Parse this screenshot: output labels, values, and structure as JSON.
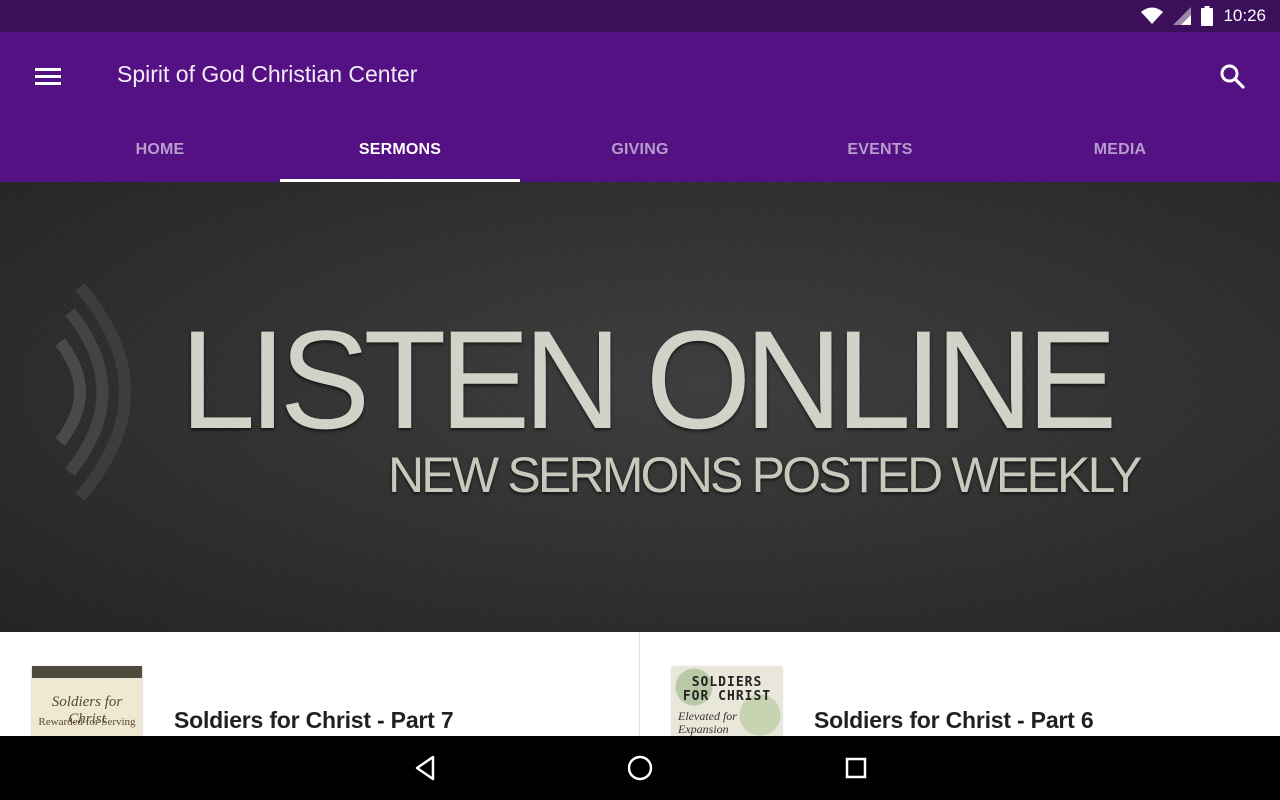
{
  "status_bar": {
    "time": "10:26",
    "icons": [
      "wifi-icon",
      "signal-icon",
      "battery-icon"
    ]
  },
  "app_bar": {
    "title": "Spirit of God Christian Center",
    "menu_icon": "hamburger-menu-icon",
    "search_icon": "search-icon",
    "background_color": "#541183"
  },
  "tabs": [
    {
      "label": "HOME",
      "active": false
    },
    {
      "label": "SERMONS",
      "active": true
    },
    {
      "label": "GIVING",
      "active": false
    },
    {
      "label": "EVENTS",
      "active": false
    },
    {
      "label": "MEDIA",
      "active": false
    }
  ],
  "hero": {
    "title": "LISTEN ONLINE",
    "subtitle": "NEW SERMONS POSTED WEEKLY"
  },
  "sermons": [
    {
      "title": "Soldiers for Christ - Part 7",
      "thumb_line1": "Soldiers for Christ",
      "thumb_line2": "Rewarded for Serving"
    },
    {
      "title": "Soldiers for Christ - Part 6",
      "thumb_line1": "SOLDIERS FOR CHRIST",
      "thumb_line2": "Elevated for Expansion"
    }
  ],
  "nav_bar": {
    "icons": [
      "back-icon",
      "home-icon",
      "recents-icon"
    ]
  }
}
